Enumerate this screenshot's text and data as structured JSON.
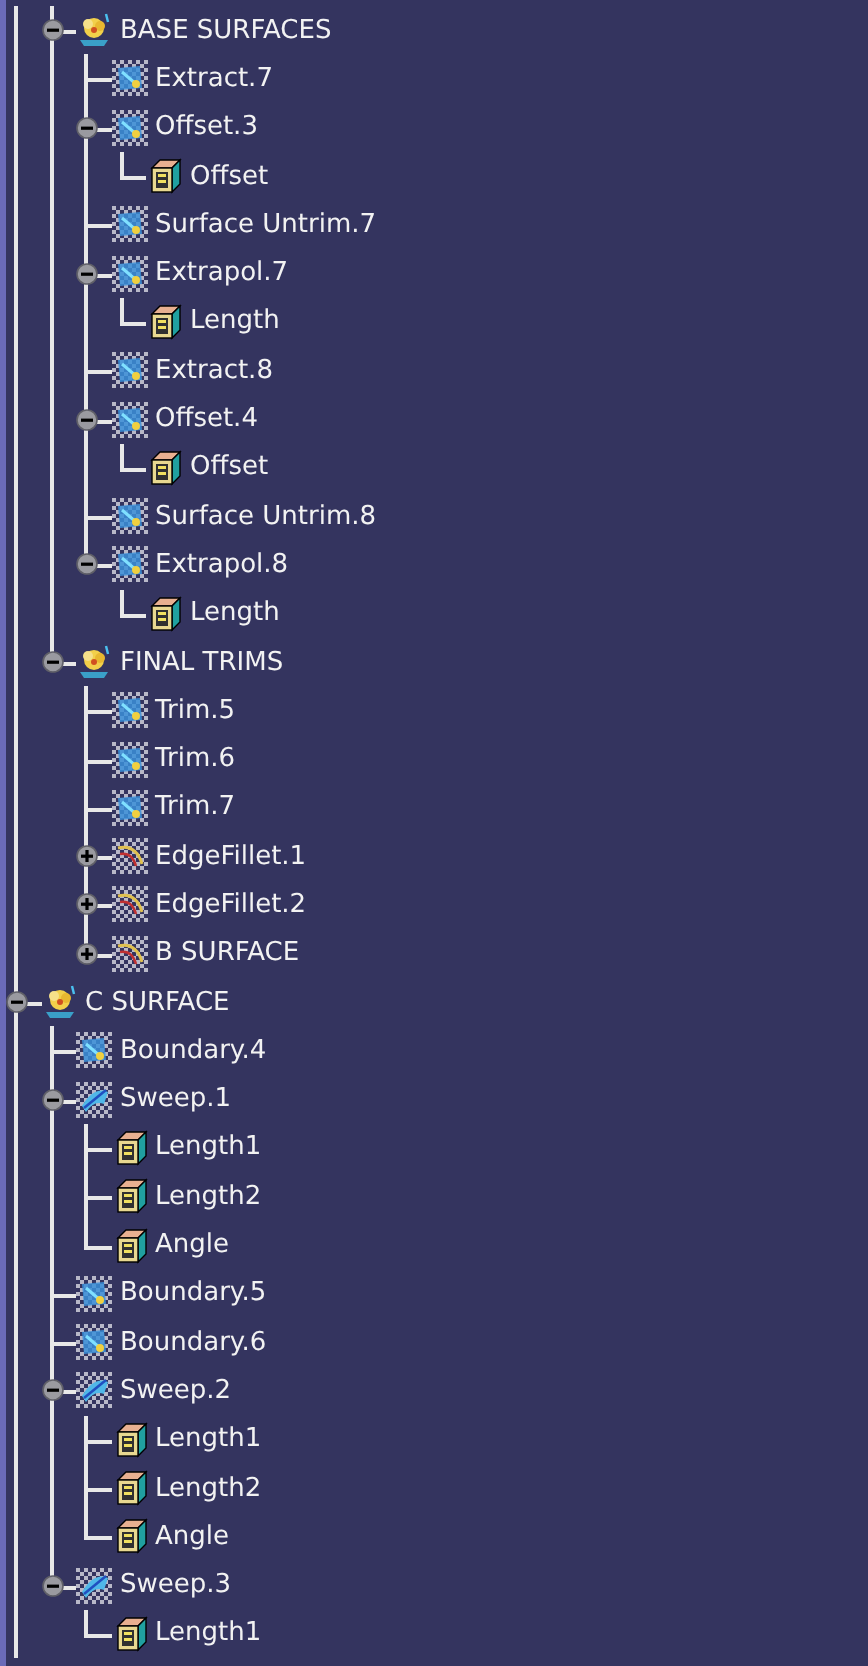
{
  "scrolled_branch": {
    "children": [
      {
        "label": "BASE SURFACES",
        "kind": "set",
        "expanded": true,
        "children": [
          {
            "label": "Extract.7",
            "kind": "feature"
          },
          {
            "label": "Offset.3",
            "kind": "feature",
            "expanded": true,
            "children": [
              {
                "label": "Offset",
                "kind": "parameter"
              }
            ]
          },
          {
            "label": "Surface Untrim.7",
            "kind": "feature"
          },
          {
            "label": "Extrapol.7",
            "kind": "feature",
            "expanded": true,
            "children": [
              {
                "label": "Length",
                "kind": "parameter"
              }
            ]
          },
          {
            "label": "Extract.8",
            "kind": "feature"
          },
          {
            "label": "Offset.4",
            "kind": "feature",
            "expanded": true,
            "children": [
              {
                "label": "Offset",
                "kind": "parameter"
              }
            ]
          },
          {
            "label": "Surface Untrim.8",
            "kind": "feature"
          },
          {
            "label": "Extrapol.8",
            "kind": "feature",
            "expanded": true,
            "children": [
              {
                "label": "Length",
                "kind": "parameter"
              }
            ]
          }
        ]
      },
      {
        "label": "FINAL TRIMS",
        "kind": "set",
        "expanded": true,
        "children": [
          {
            "label": "Trim.5",
            "kind": "feature"
          },
          {
            "label": "Trim.6",
            "kind": "feature"
          },
          {
            "label": "Trim.7",
            "kind": "feature"
          },
          {
            "label": "EdgeFillet.1",
            "kind": "fillet",
            "expanded": false
          },
          {
            "label": "EdgeFillet.2",
            "kind": "fillet",
            "expanded": false
          },
          {
            "label": "B SURFACE",
            "kind": "fillet",
            "expanded": false
          }
        ]
      }
    ]
  },
  "nodes": [
    {
      "label": "C SURFACE",
      "kind": "set",
      "expanded": true,
      "children": [
        {
          "label": "Boundary.4",
          "kind": "feature"
        },
        {
          "label": "Sweep.1",
          "kind": "sweep",
          "expanded": true,
          "children": [
            {
              "label": "Length1",
              "kind": "parameter"
            },
            {
              "label": "Length2",
              "kind": "parameter"
            },
            {
              "label": "Angle",
              "kind": "parameter"
            }
          ]
        },
        {
          "label": "Boundary.5",
          "kind": "feature"
        },
        {
          "label": "Boundary.6",
          "kind": "feature"
        },
        {
          "label": "Sweep.2",
          "kind": "sweep",
          "expanded": true,
          "children": [
            {
              "label": "Length1",
              "kind": "parameter"
            },
            {
              "label": "Length2",
              "kind": "parameter"
            },
            {
              "label": "Angle",
              "kind": "parameter"
            }
          ]
        },
        {
          "label": "Sweep.3",
          "kind": "sweep",
          "expanded": true,
          "children": [
            {
              "label": "Length1",
              "kind": "parameter"
            }
          ]
        }
      ]
    }
  ]
}
